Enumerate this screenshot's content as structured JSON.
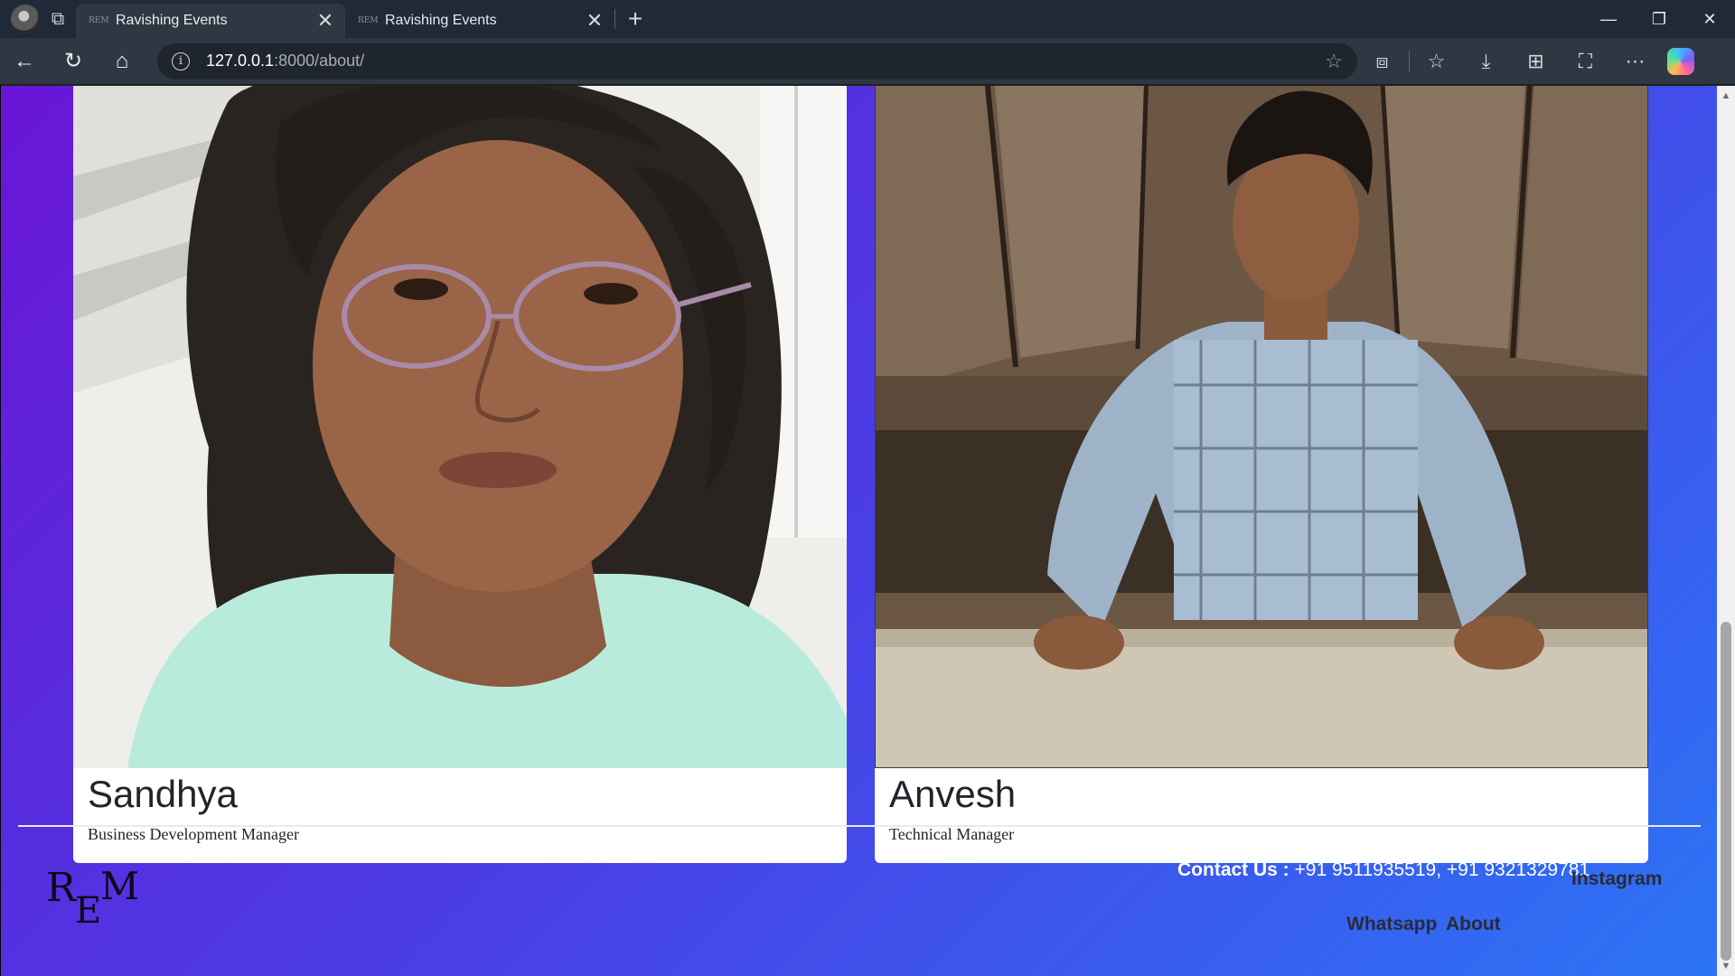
{
  "browser": {
    "tabs": [
      {
        "title": "Ravishing Events",
        "favicon": "REM",
        "active": true
      },
      {
        "title": "Ravishing Events",
        "favicon": "REM",
        "active": false
      }
    ],
    "url_host": "127.0.0.1",
    "url_path": ":8000/about/",
    "icons": {
      "workspaces": "⧉",
      "close": "✕",
      "new_tab": "+",
      "minimize": "—",
      "restore": "❐",
      "win_close": "✕",
      "back": "←",
      "reload": "↻",
      "home": "⌂",
      "info": "i",
      "star": "☆",
      "extensions": "⧈",
      "favorites": "☆",
      "downloads": "⤓",
      "collections": "⊞",
      "screenshot": "⛶",
      "more": "⋯"
    }
  },
  "team": [
    {
      "name": "Sandhya",
      "role": "Business Development Manager"
    },
    {
      "name": "Anvesh",
      "role": "Technical Manager"
    }
  ],
  "footer": {
    "logo_text": "REM",
    "contact_label": "Contact Us :",
    "contact_numbers": " +91 9511935519, +91 9321329781",
    "links": {
      "instagram": "Instagram",
      "whatsapp": "Whatsapp",
      "about": "About"
    }
  },
  "scrollbar": {
    "up": "▲",
    "down": "▼"
  },
  "colors": {
    "gradient_start": "#6a15d6",
    "gradient_end": "#2c74f5",
    "card": "#ffffff",
    "link": "#2a2a38"
  }
}
